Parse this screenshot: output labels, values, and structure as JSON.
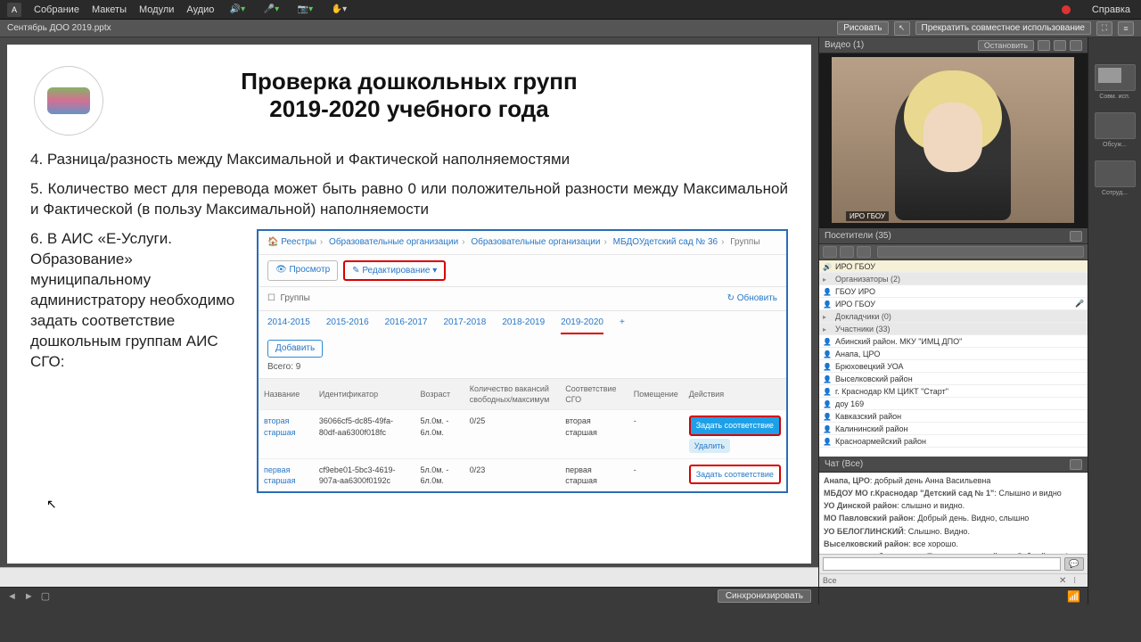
{
  "topbar": {
    "logo": "A",
    "menus": [
      "Собрание",
      "Макеты",
      "Модули",
      "Аудио"
    ],
    "help": "Справка"
  },
  "docbar": {
    "filename": "Сентябрь ДОО 2019.pptx",
    "draw": "Рисовать",
    "stop_share": "Прекратить совместное использование"
  },
  "slide": {
    "title_l1": "Проверка дошкольных групп",
    "title_l2": "2019-2020 учебного года",
    "p4": "4. Разница/разность между Максимальной и Фактической наполняемостями",
    "p5": "5. Количество мест для перевода может быть равно 0 или положительной разности между Максимальной и Фактической (в пользу Максимальной) наполняемости",
    "p6": "6. В АИС «Е-Услуги. Образование» муниципальному администратору необходимо задать соответствие дошкольным группам АИС СГО:"
  },
  "ais": {
    "crumbs": [
      "Реестры",
      "Образовательные организации",
      "Образовательные организации",
      "МБДОУдетский сад № 36",
      "Группы"
    ],
    "view": "👁 Просмотр",
    "edit": "✎ Редактирование ▾",
    "groups_lbl": "Группы",
    "refresh": "↻ Обновить",
    "tabs": [
      "2014-2015",
      "2015-2016",
      "2016-2017",
      "2017-2018",
      "2018-2019",
      "2019-2020"
    ],
    "active_tab": 5,
    "add": "Добавить",
    "total": "Всего: 9",
    "headers": [
      "Название",
      "Идентификатор",
      "Возраст",
      "Количество вакансий свободных/максимум",
      "Соответствие СГО",
      "Помещение",
      "Действия"
    ],
    "rows": [
      {
        "name": "вторая старшая",
        "id": "36066cf5-dc85-49fa-80df-aa6300f018fc",
        "age": "5л.0м. - 6л.0м.",
        "vac": "0/25",
        "sgo": "вторая старшая",
        "room": "-",
        "act": "Задать соответствие",
        "del": "Удалить",
        "style": "blue"
      },
      {
        "name": "первая старшая",
        "id": "cf9ebe01-5bc3-4619-907a-aa6300f0192c",
        "age": "5л.0м. - 6л.0м.",
        "vac": "0/23",
        "sgo": "первая старшая",
        "room": "-",
        "act": "Задать соответствие",
        "style": "white"
      }
    ]
  },
  "video": {
    "title": "Видео  (1)",
    "stop": "Остановить",
    "speaker": "ИРО ГБОУ"
  },
  "attendees": {
    "title": "Посетители  (35)",
    "me": "ИРО ГБОУ",
    "sections": [
      {
        "label": "Организаторы (2)",
        "items": [
          {
            "n": "ГБОУ ИРО"
          },
          {
            "n": "ИРО ГБОУ",
            "mic": true
          }
        ]
      },
      {
        "label": "Докладчики (0)",
        "items": []
      },
      {
        "label": "Участники (33)",
        "items": [
          {
            "n": "Абинский район. МКУ \"ИМЦ ДПО\""
          },
          {
            "n": "Анапа, ЦРО"
          },
          {
            "n": "Брюховецкий УОА"
          },
          {
            "n": "Выселковский район"
          },
          {
            "n": "г. Краснодар КМ ЦИКТ \"Старт\""
          },
          {
            "n": "доу 169"
          },
          {
            "n": "Кавказский район"
          },
          {
            "n": "Калининский район"
          },
          {
            "n": "Красноармейский район"
          }
        ]
      }
    ]
  },
  "chat": {
    "title": "Чат  (Все)",
    "messages": [
      {
        "a": "Анапа, ЦРО",
        "t": ": добрый день Анна Васильевна"
      },
      {
        "a": "МБДОУ МО г.Краснодар \"Детский сад № 1\"",
        "t": ": Слышно и видно"
      },
      {
        "a": "УО Динской район",
        "t": ": слышно и видно."
      },
      {
        "a": "МО Павловский район",
        "t": ": Добрый день. Видно, слышно"
      },
      {
        "a": "УО БЕЛОГЛИНСКИЙ",
        "t": ": Слышно. Видно."
      },
      {
        "a": "Выселковский район",
        "t": ": все хорошо."
      },
      {
        "a": "управления образования Туапсинского района",
        "t": ": Добрый день!"
      }
    ],
    "all": "Все"
  },
  "footer": {
    "sync": "Синхронизировать"
  },
  "pods": [
    "Совм. исп.",
    "Обсуж...",
    "Сотруд..."
  ]
}
